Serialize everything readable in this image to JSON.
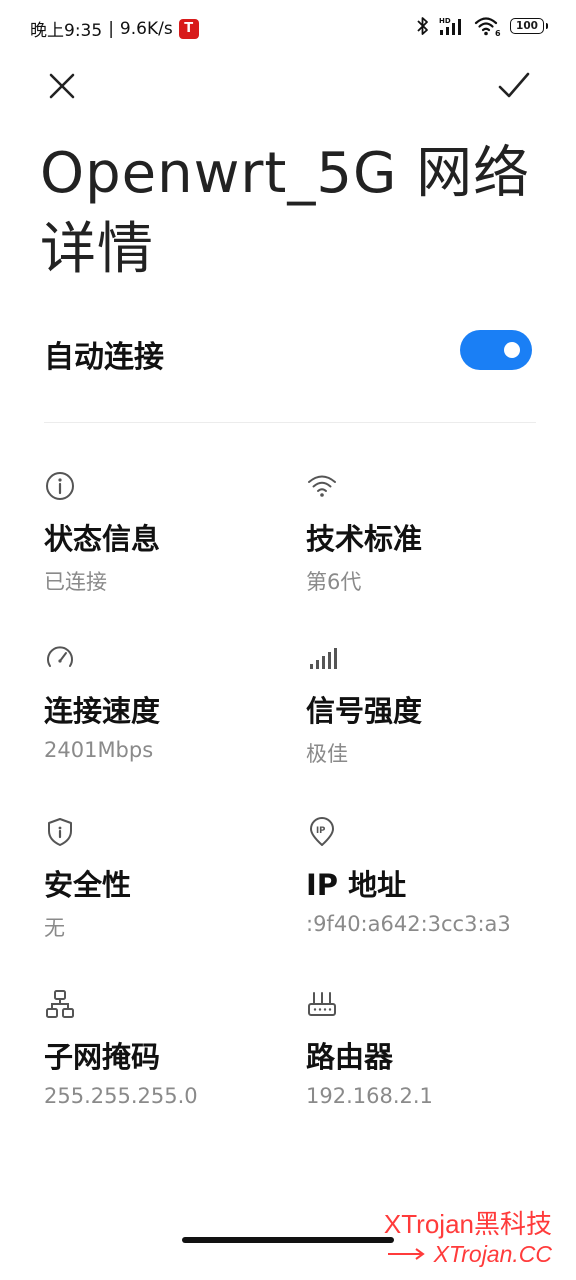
{
  "status_bar": {
    "time": "晚上9:35",
    "separator": "|",
    "net_speed": "9.6K/s",
    "battery": "100"
  },
  "header": {
    "title": "Openwrt_5G 网络详情"
  },
  "auto_connect": {
    "label": "自动连接",
    "enabled": true
  },
  "info": {
    "status": {
      "label": "状态信息",
      "value": "已连接",
      "icon": "info-icon"
    },
    "standard": {
      "label": "技术标准",
      "value": "第6代",
      "icon": "wifi-icon"
    },
    "speed": {
      "label": "连接速度",
      "value": "2401Mbps",
      "icon": "speedometer-icon"
    },
    "signal": {
      "label": "信号强度",
      "value": "极佳",
      "icon": "signal-bars-icon"
    },
    "security": {
      "label": "安全性",
      "value": "无",
      "icon": "shield-icon"
    },
    "ip": {
      "label": "IP 地址",
      "value": ":9f40:a642:3cc3:a3",
      "icon": "ip-pin-icon"
    },
    "subnet": {
      "label": "子网掩码",
      "value": "255.255.255.0",
      "icon": "network-icon"
    },
    "router": {
      "label": "路由器",
      "value": "192.168.2.1",
      "icon": "router-icon"
    }
  },
  "watermark": {
    "line1": "XTrojan黑科技",
    "line2": "XTrojan.CC"
  },
  "colors": {
    "accent": "#1a7ff5",
    "watermark": "#ff3b3b"
  }
}
